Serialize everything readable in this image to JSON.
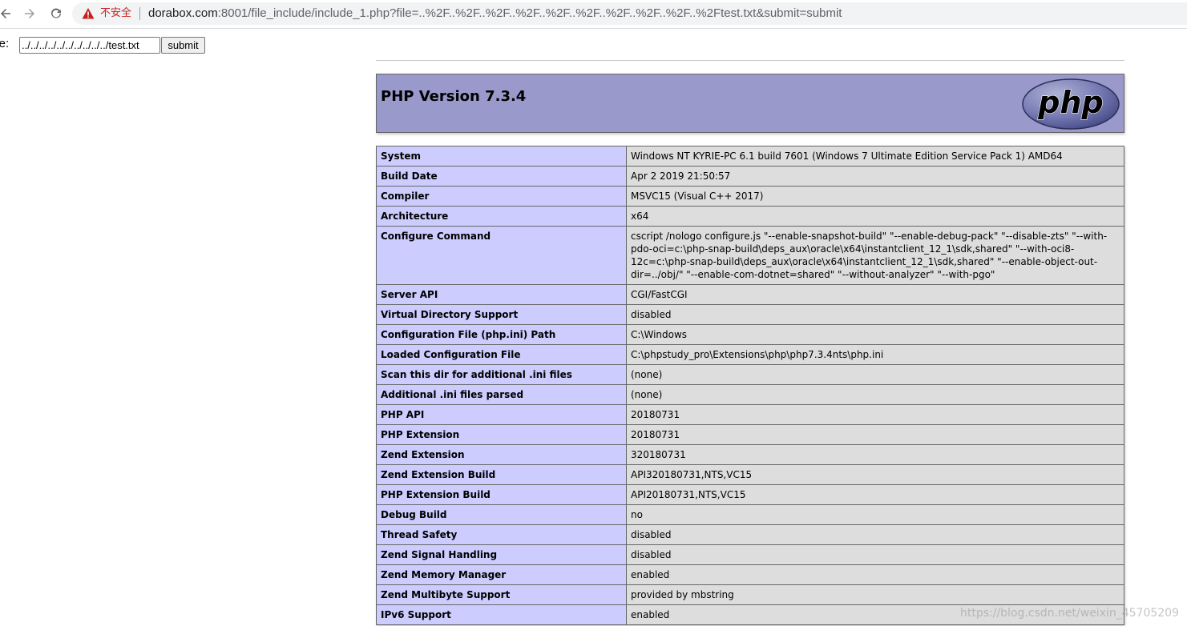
{
  "browser": {
    "security_label": "不安全",
    "url_host": "dorabox.com",
    "url_rest": ":8001/file_include/include_1.php?file=..%2F..%2F..%2F..%2F..%2F..%2F..%2F..%2F..%2F..%2Ftest.txt&submit=submit",
    "icons": [
      "back-arrow-icon",
      "forward-arrow-icon",
      "reload-icon",
      "warning-triangle-icon"
    ]
  },
  "form": {
    "label": "ile:",
    "file_value": "../../../../../../../../../../test.txt",
    "submit_label": "submit"
  },
  "phpinfo": {
    "version_title": "PHP Version 7.3.4",
    "logo_text": "php",
    "colors": {
      "header_bg": "#9999cc",
      "key_bg": "#ccccff",
      "value_bg": "#dddddd",
      "border": "#666666"
    },
    "rows": [
      {
        "key": "System",
        "value": "Windows NT KYRIE-PC 6.1 build 7601 (Windows 7 Ultimate Edition Service Pack 1) AMD64"
      },
      {
        "key": "Build Date",
        "value": "Apr 2 2019 21:50:57"
      },
      {
        "key": "Compiler",
        "value": "MSVC15 (Visual C++ 2017)"
      },
      {
        "key": "Architecture",
        "value": "x64"
      },
      {
        "key": "Configure Command",
        "value": "cscript /nologo configure.js \"--enable-snapshot-build\" \"--enable-debug-pack\" \"--disable-zts\" \"--with-pdo-oci=c:\\php-snap-build\\deps_aux\\oracle\\x64\\instantclient_12_1\\sdk,shared\" \"--with-oci8-12c=c:\\php-snap-build\\deps_aux\\oracle\\x64\\instantclient_12_1\\sdk,shared\" \"--enable-object-out-dir=../obj/\" \"--enable-com-dotnet=shared\" \"--without-analyzer\" \"--with-pgo\""
      },
      {
        "key": "Server API",
        "value": "CGI/FastCGI"
      },
      {
        "key": "Virtual Directory Support",
        "value": "disabled"
      },
      {
        "key": "Configuration File (php.ini) Path",
        "value": "C:\\Windows"
      },
      {
        "key": "Loaded Configuration File",
        "value": "C:\\phpstudy_pro\\Extensions\\php\\php7.3.4nts\\php.ini"
      },
      {
        "key": "Scan this dir for additional .ini files",
        "value": "(none)"
      },
      {
        "key": "Additional .ini files parsed",
        "value": "(none)"
      },
      {
        "key": "PHP API",
        "value": "20180731"
      },
      {
        "key": "PHP Extension",
        "value": "20180731"
      },
      {
        "key": "Zend Extension",
        "value": "320180731"
      },
      {
        "key": "Zend Extension Build",
        "value": "API320180731,NTS,VC15"
      },
      {
        "key": "PHP Extension Build",
        "value": "API20180731,NTS,VC15"
      },
      {
        "key": "Debug Build",
        "value": "no"
      },
      {
        "key": "Thread Safety",
        "value": "disabled"
      },
      {
        "key": "Zend Signal Handling",
        "value": "disabled"
      },
      {
        "key": "Zend Memory Manager",
        "value": "enabled"
      },
      {
        "key": "Zend Multibyte Support",
        "value": "provided by mbstring"
      },
      {
        "key": "IPv6 Support",
        "value": "enabled"
      }
    ]
  },
  "watermark": "https://blog.csdn.net/weixin_45705209"
}
